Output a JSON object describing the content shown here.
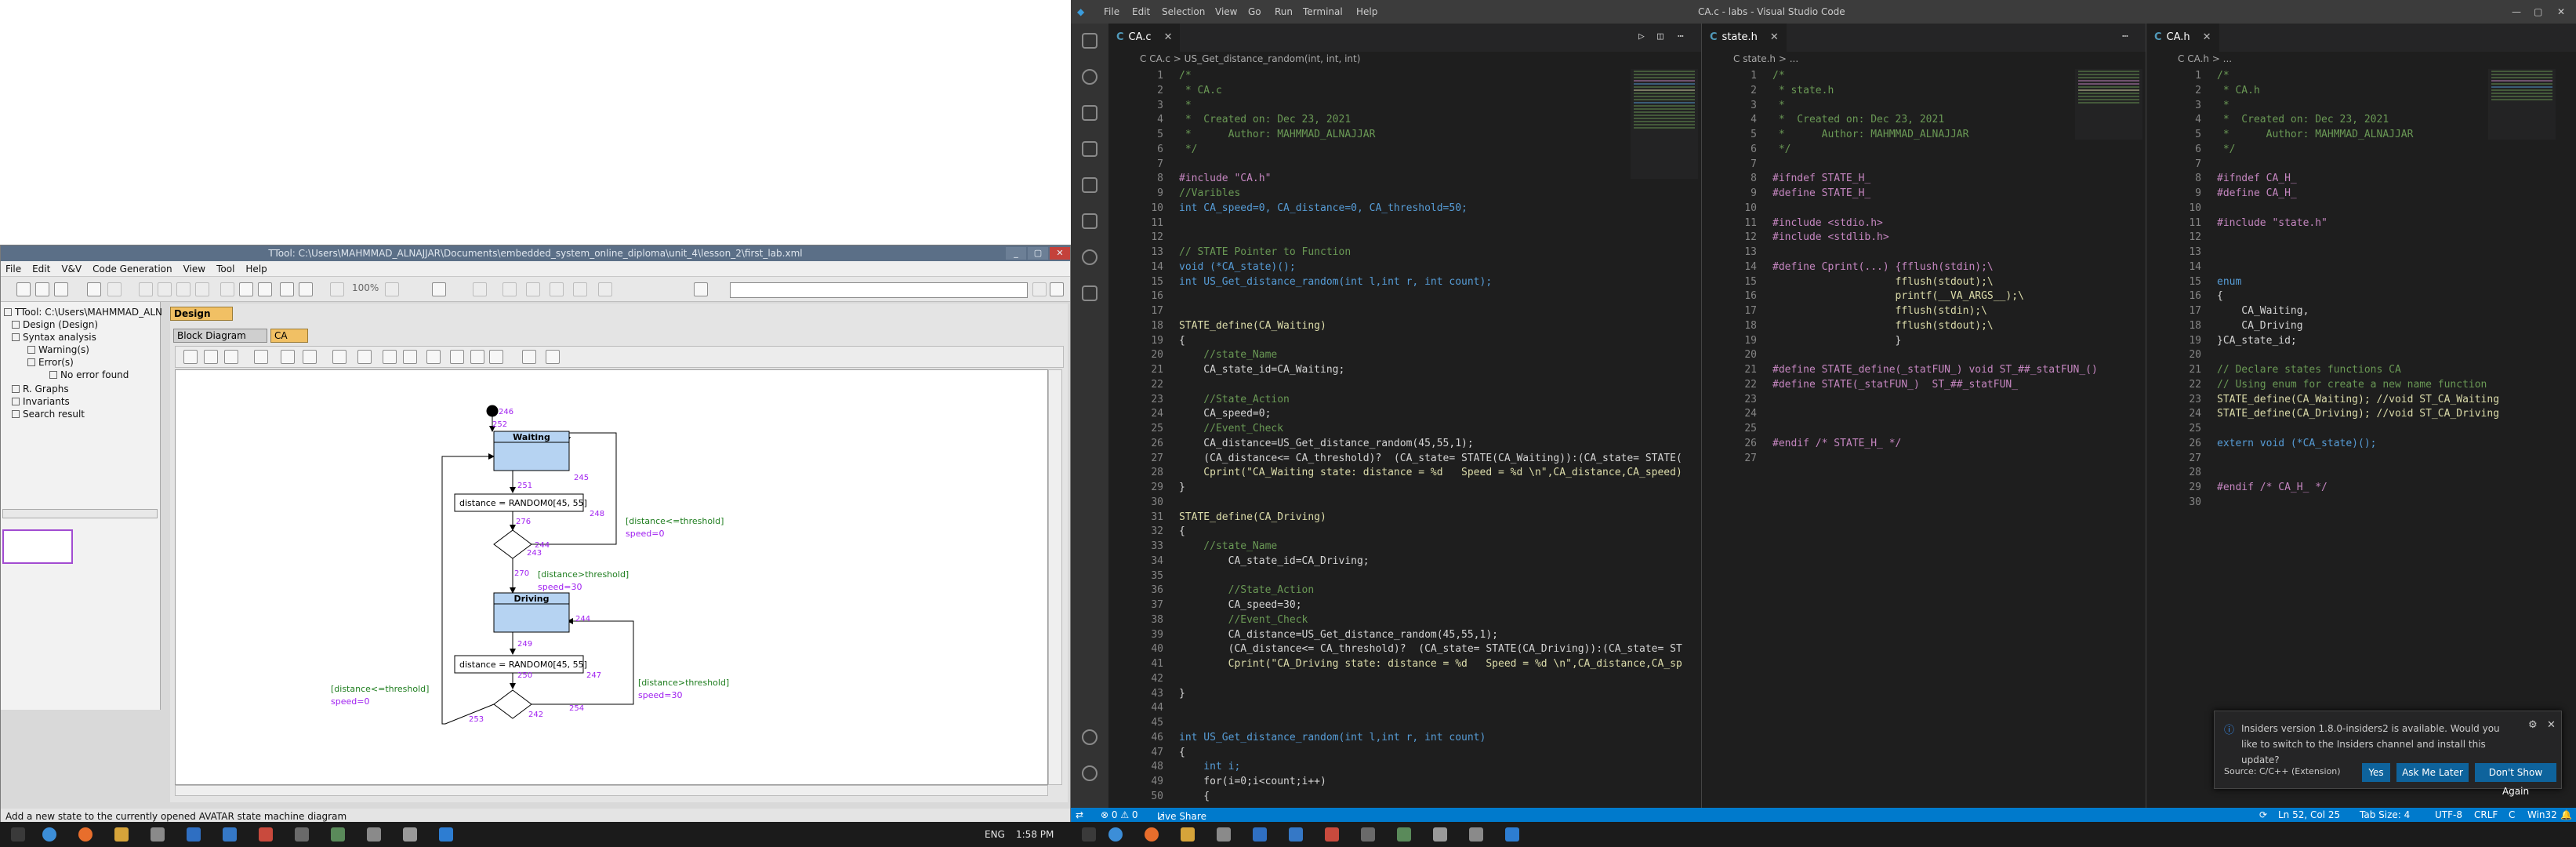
{
  "colors": {
    "ttool_title": "#5b6f87",
    "tab_orange": "#f1c064",
    "state_fill": "#b6d3f2",
    "vs_accent": "#007acc",
    "comment": "#6a9955",
    "keyword": "#569cd6",
    "string": "#ce9178",
    "macro": "#c586c0",
    "function": "#dcdcaa"
  },
  "ttool": {
    "title": "TTool: C:\\Users\\MAHMMAD_ALNAJJAR\\Documents\\embedded_system_online_diploma\\unit_4\\lesson_2\\first_lab.xml",
    "menu": [
      "File",
      "Edit",
      "V&V",
      "Code Generation",
      "View",
      "Tool",
      "Help"
    ],
    "zoom": "100%",
    "tree": {
      "root": "TTool: C:\\Users\\MAHMMAD_ALN",
      "design": "Design (Design)",
      "syntax": "Syntax analysis",
      "warnings": "Warning(s)",
      "errors": "Error(s)",
      "no_error": "No error found",
      "graphs": "R. Graphs",
      "invariants": "Invariants",
      "search": "Search result"
    },
    "tabs": {
      "design": "Design",
      "block": "Block Diagram",
      "ca": "CA"
    },
    "status": "Add a new state to the currently opened AVATAR state machine diagram",
    "diagram": {
      "state1": "Waiting",
      "state2": "Driving",
      "action1": "distance = RANDOM0[45, 55]",
      "action2": "distance = RANDOM0[45, 55]",
      "guard1": "[distance<=threshold]",
      "guard1_act": "speed=0",
      "guard2": "[distance>threshold]",
      "guard2_act": "speed=30",
      "guard3": "[distance>threshold]",
      "guard3_act": "speed=30",
      "guard4": "[distance<=threshold]",
      "guard4_act": "speed=0",
      "ids": [
        "246",
        "252",
        "245",
        "251",
        "276",
        "243",
        "244",
        "248",
        "270",
        "249",
        "250",
        "247",
        "242",
        "253",
        "254",
        "244"
      ]
    }
  },
  "vscode": {
    "title": "CA.c - labs - Visual Studio Code",
    "menu": [
      "File",
      "Edit",
      "Selection",
      "View",
      "Go",
      "Run",
      "Terminal",
      "Help"
    ],
    "tabs": [
      "CA.c",
      "state.h",
      "CA.h"
    ],
    "crumb1": "C  CA.c  >  US_Get_distance_random(int, int, int)",
    "crumb2": "C  state.h  >  ...",
    "crumb3": "C  CA.h  >  ...",
    "code_ca_c": [
      "/*",
      " * CA.c",
      " *",
      " *  Created on: Dec 23, 2021",
      " *      Author: MAHMMAD_ALNAJJAR",
      " */",
      "",
      "#include \"CA.h\"",
      "//Varibles",
      "int CA_speed=0, CA_distance=0, CA_threshold=50;",
      "",
      "",
      "// STATE Pointer to Function",
      "void (*CA_state)();",
      "int US_Get_distance_random(int l,int r, int count);",
      "",
      "",
      "STATE_define(CA_Waiting)",
      "{",
      "    //state_Name",
      "    CA_state_id=CA_Waiting;",
      "",
      "    //State_Action",
      "    CA_speed=0;",
      "    //Event_Check",
      "    CA_distance=US_Get_distance_random(45,55,1);",
      "    (CA_distance<= CA_threshold)?  (CA_state= STATE(CA_Waiting)):(CA_state= STATE(",
      "    Cprint(\"CA_Waiting state: distance = %d   Speed = %d \\n\",CA_distance,CA_speed)",
      "}",
      "",
      "STATE_define(CA_Driving)",
      "{",
      "    //state_Name",
      "        CA_state_id=CA_Driving;",
      "",
      "        //State_Action",
      "        CA_speed=30;",
      "        //Event_Check",
      "        CA_distance=US_Get_distance_random(45,55,1);",
      "        (CA_distance<= CA_threshold)?  (CA_state= STATE(CA_Driving)):(CA_state= ST",
      "        Cprint(\"CA_Driving state: distance = %d   Speed = %d \\n\",CA_distance,CA_sp",
      "",
      "}",
      "",
      "",
      "int US_Get_distance_random(int l,int r, int count)",
      "{",
      "    int i;",
      "    for(i=0;i<count;i++)",
      "    {"
    ],
    "code_state_h": [
      "/*",
      " * state.h",
      " *",
      " *  Created on: Dec 23, 2021",
      " *      Author: MAHMMAD_ALNAJJAR",
      " */",
      "",
      "#ifndef STATE_H_",
      "#define STATE_H_",
      "",
      "#include <stdio.h>",
      "#include <stdlib.h>",
      "",
      "#define Cprint(...) {fflush(stdin);\\",
      "                    fflush(stdout);\\",
      "                    printf(__VA_ARGS__);\\",
      "                    fflush(stdin);\\",
      "                    fflush(stdout);\\",
      "                    }",
      "",
      "#define STATE_define(_statFUN_) void ST_##_statFUN_()",
      "#define STATE(_statFUN_)  ST_##_statFUN_",
      "",
      "",
      "",
      "#endif /* STATE_H_ */",
      ""
    ],
    "code_ca_h": [
      "/*",
      " * CA.h",
      " *",
      " *  Created on: Dec 23, 2021",
      " *      Author: MAHMMAD_ALNAJJAR",
      " */",
      "",
      "#ifndef CA_H_",
      "#define CA_H_",
      "",
      "#include \"state.h\"",
      "",
      "",
      "",
      "enum",
      "{",
      "    CA_Waiting,",
      "    CA_Driving",
      "}CA_state_id;",
      "",
      "// Declare states functions CA",
      "// Using enum for create a new name function",
      "STATE_define(CA_Waiting); //void ST_CA_Waiting",
      "STATE_define(CA_Driving); //void ST_CA_Driving",
      "",
      "extern void (*CA_state)();",
      "",
      "",
      "#endif /* CA_H_ */",
      ""
    ],
    "notification": {
      "message": "Insiders version 1.8.0-insiders2 is available. Would you like to switch to the Insiders channel and install this update?",
      "source": "Source: C/C++ (Extension)",
      "yes": "Yes",
      "later": "Ask Me Later",
      "never": "Don't Show Again"
    },
    "status": {
      "errors": "⊗ 0 ⚠ 0",
      "live": "Live Share",
      "position": "Ln 52, Col 25",
      "tab": "Tab Size: 4",
      "encoding": "UTF-8",
      "eol": "CRLF",
      "lang": "C",
      "platform": "Win32"
    }
  },
  "taskbar": {
    "lang": "ENG",
    "time": "1:58 PM"
  }
}
